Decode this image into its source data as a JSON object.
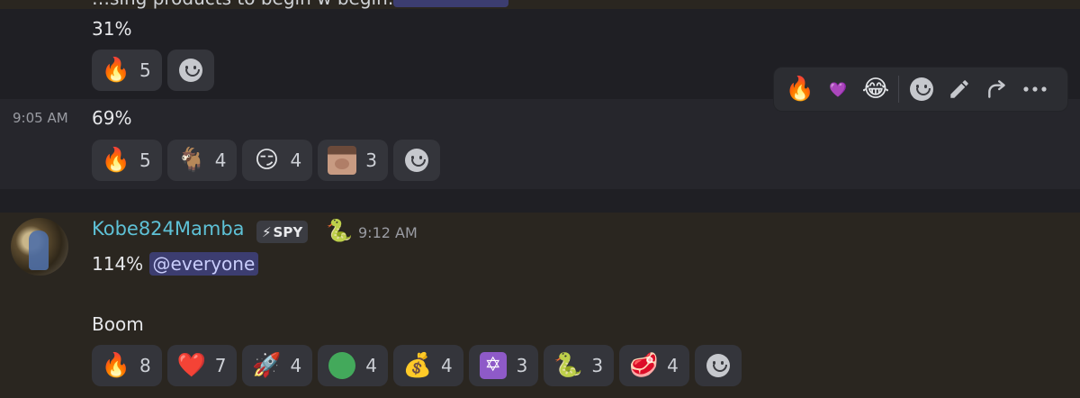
{
  "previous": {
    "cut_text": "…sing products to begin w begin…",
    "message_1": {
      "text": "31%",
      "reactions": [
        {
          "emoji": "🔥",
          "count": "5"
        }
      ]
    },
    "message_2": {
      "timestamp": "9:05 AM",
      "text": "69%",
      "reactions": [
        {
          "emoji": "🔥",
          "count": "5"
        },
        {
          "emoji": "🐐",
          "count": "4"
        },
        {
          "emoji": "😏",
          "count": "4"
        },
        {
          "emoji": "custom-face",
          "count": "3"
        }
      ]
    }
  },
  "hover_toolbar": {
    "quick_reactions": [
      "🔥",
      "💜",
      "😂"
    ],
    "actions": [
      "add-reaction",
      "edit",
      "forward",
      "more"
    ]
  },
  "main_message": {
    "username": "Kobe824Mamba",
    "badge": {
      "icon": "⚡",
      "label": "SPY"
    },
    "badge_emoji": "🐍",
    "timestamp": "9:12 AM",
    "line1_text": "114%",
    "mention": "@everyone",
    "line2_text": "Boom",
    "reactions": [
      {
        "emoji": "🔥",
        "count": "8"
      },
      {
        "emoji": "❤️",
        "count": "7"
      },
      {
        "emoji": "🚀",
        "count": "4"
      },
      {
        "emoji": "green-circle",
        "count": "4"
      },
      {
        "emoji": "💰",
        "count": "4"
      },
      {
        "emoji": "✡",
        "count": "3"
      },
      {
        "emoji": "🐍",
        "count": "3"
      },
      {
        "emoji": "🥩",
        "count": "4"
      }
    ]
  },
  "colors": {
    "username": "#5ec1d6",
    "mention_bg": "#3c3d70",
    "reaction_bg": "#34353b"
  }
}
